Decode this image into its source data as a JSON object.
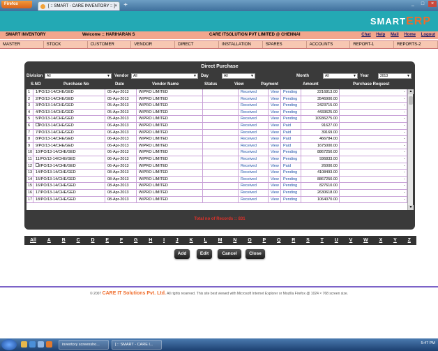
{
  "browser": {
    "app_button": "Firefox",
    "tab_title": "[ :: SMART - CARE INVENTORY :: ]",
    "tab_close": "×",
    "new_tab": "+",
    "window_controls": [
      "_",
      "□",
      "×"
    ]
  },
  "header": {
    "logo_smart": "SMART",
    "logo_erp": "ERP",
    "app_name": "SMART INVENTORY",
    "welcome": "Welcome :: HARIHARAN S",
    "company": "CARE ITSOLUTION PVT LIMITED @ CHENNAI",
    "links": [
      "Chat",
      "Help",
      "Mail",
      "Home",
      "Logout"
    ]
  },
  "menu": [
    "MASTER",
    "STOCK",
    "CUSTOMER",
    "VENDOR",
    "DIRECT",
    "INSTALLATION",
    "SPARES",
    "ACCOUNTS",
    "REPORT-1",
    "REPORTS-2"
  ],
  "panel": {
    "title": "Direct Purchase",
    "filters": {
      "division_label": "Division",
      "division_value": "All",
      "vendor_label": "Vendor",
      "vendor_value": "All",
      "day_label": "Day",
      "day_value": "All",
      "month_label": "Month",
      "month_value": "All",
      "year_label": "Year",
      "year_value": "2013"
    },
    "columns": [
      "S.NO",
      "Purchase No",
      "Date",
      "Vendor Name",
      "Status",
      "View",
      "Payment",
      "Amount",
      "Purchase Request"
    ],
    "rows": [
      {
        "sno": "1",
        "pno": "1/PO/13-14/CHE/GED",
        "date": "05-Apr-2013",
        "vendor": "WIPRO LIMITED",
        "status": "",
        "view": "Received",
        "pview": "View",
        "pay": "Pending",
        "amount": "2216813.00",
        "req": "-",
        "cb": false
      },
      {
        "sno": "2",
        "pno": "2/PO/13-14/CHE/GED",
        "date": "05-Apr-2013",
        "vendor": "WIPRO LIMITED",
        "status": "",
        "view": "Received",
        "pview": "View",
        "pay": "Pending",
        "amount": "3546900.00",
        "req": "-",
        "cb": false
      },
      {
        "sno": "3",
        "pno": "3/PO/13-14/CHE/GED",
        "date": "05-Apr-2013",
        "vendor": "WIPRO LIMITED",
        "status": "",
        "view": "Received",
        "pview": "View",
        "pay": "Pending",
        "amount": "2423715.00",
        "req": "-",
        "cb": false
      },
      {
        "sno": "4",
        "pno": "4/PO/13-14/CHE/GED",
        "date": "05-Apr-2013",
        "vendor": "WIPRO LIMITED",
        "status": "",
        "view": "Received",
        "pview": "View",
        "pay": "Pending",
        "amount": "4433625.00",
        "req": "-",
        "cb": false
      },
      {
        "sno": "5",
        "pno": "5/PO/13-14/CHE/GED",
        "date": "05-Apr-2013",
        "vendor": "WIPRO LIMITED",
        "status": "",
        "view": "Received",
        "pview": "View",
        "pay": "Pending",
        "amount": "10936275.00",
        "req": "-",
        "cb": false
      },
      {
        "sno": "6",
        "pno": "6/PO/13-14/CHE/GED",
        "date": "06-Apr-2013",
        "vendor": "WIPRO LIMITED",
        "status": "",
        "view": "Received",
        "pview": "View",
        "pay": "Paid",
        "amount": "91627.00",
        "req": "-",
        "cb": true
      },
      {
        "sno": "7",
        "pno": "7/PO/13-14/CHE/GED",
        "date": "06-Apr-2013",
        "vendor": "WIPRO LIMITED",
        "status": "",
        "view": "Received",
        "pview": "View",
        "pay": "Paid",
        "amount": "39169.00",
        "req": "-",
        "cb": false
      },
      {
        "sno": "8",
        "pno": "8/PO/13-14/CHE/GED",
        "date": "06-Apr-2013",
        "vendor": "WIPRO LIMITED",
        "status": "",
        "view": "Received",
        "pview": "View",
        "pay": "Paid",
        "amount": "466784.00",
        "req": "-",
        "cb": false
      },
      {
        "sno": "9",
        "pno": "9/PO/13-14/CHE/GED",
        "date": "06-Apr-2013",
        "vendor": "WIPRO LIMITED",
        "status": "",
        "view": "Received",
        "pview": "View",
        "pay": "Paid",
        "amount": "1675000.00",
        "req": "-",
        "cb": false
      },
      {
        "sno": "10",
        "pno": "10/PO/13-14/CHE/GED",
        "date": "06-Apr-2013",
        "vendor": "WIPRO LIMITED",
        "status": "",
        "view": "Received",
        "pview": "View",
        "pay": "Pending",
        "amount": "8867250.00",
        "req": "-",
        "cb": false
      },
      {
        "sno": "11",
        "pno": "11/PO/13-14/CHE/GED",
        "date": "06-Apr-2013",
        "vendor": "WIPRO LIMITED",
        "status": "",
        "view": "Received",
        "pview": "View",
        "pay": "Pending",
        "amount": "936833.00",
        "req": "-",
        "cb": false
      },
      {
        "sno": "12",
        "pno": "13/PO/13-14/CHE/GED",
        "date": "06-Apr-2013",
        "vendor": "WIPRO LIMITED",
        "status": "",
        "view": "Received",
        "pview": "View",
        "pay": "Paid",
        "amount": "26000.00",
        "req": "-",
        "cb": true
      },
      {
        "sno": "13",
        "pno": "14/PO/13-14/CHE/GED",
        "date": "08-Apr-2013",
        "vendor": "WIPRO LIMITED",
        "status": "",
        "view": "Received",
        "pview": "View",
        "pay": "Pending",
        "amount": "4108493.00",
        "req": "-",
        "cb": false
      },
      {
        "sno": "14",
        "pno": "15/PO/13-14/CHE/GED",
        "date": "08-Apr-2013",
        "vendor": "WIPRO LIMITED",
        "status": "",
        "view": "Received",
        "pview": "View",
        "pay": "Pending",
        "amount": "8867250.00",
        "req": "-",
        "cb": false
      },
      {
        "sno": "15",
        "pno": "16/PO/13-14/CHE/GED",
        "date": "08-Apr-2013",
        "vendor": "WIPRO LIMITED",
        "status": "",
        "view": "Received",
        "pview": "View",
        "pay": "Pending",
        "amount": "827610.00",
        "req": "-",
        "cb": false
      },
      {
        "sno": "16",
        "pno": "17/PO/13-14/CHE/GED",
        "date": "08-Apr-2013",
        "vendor": "WIPRO LIMITED",
        "status": "",
        "view": "Received",
        "pview": "View",
        "pay": "Pending",
        "amount": "2630618.00",
        "req": "-",
        "cb": false
      },
      {
        "sno": "17",
        "pno": "18/PO/13-14/CHE/GED",
        "date": "08-Apr-2013",
        "vendor": "WIPRO LIMITED",
        "status": "",
        "view": "Received",
        "pview": "View",
        "pay": "Pending",
        "amount": "1064070.00",
        "req": "-",
        "cb": false
      }
    ],
    "total": "Total no of Records :: 831"
  },
  "alphabet": [
    "All",
    "A",
    "B",
    "C",
    "D",
    "E",
    "F",
    "G",
    "H",
    "I",
    "J",
    "K",
    "L",
    "M",
    "N",
    "O",
    "P",
    "Q",
    "R",
    "S",
    "T",
    "U",
    "V",
    "W",
    "X",
    "Y",
    "Z"
  ],
  "buttons": [
    "Add",
    "Edit",
    "Cancel",
    "Close"
  ],
  "footer": {
    "copy": "© 2007",
    "company": "CARE IT Solutions Pvt. Ltd.",
    "note": "All rights reserved.   This site best viewed with Microsoft Internet Explorer or Mozilla Firefox @ 1024 × 768 screen size."
  },
  "taskbar": {
    "items": [
      "inventory screensho...",
      "[ :: SMART - CARE I..."
    ],
    "clock": "5:47 PM"
  },
  "colors": {
    "banner": "#23a9b4",
    "accent": "#ef6b2a",
    "panel": "#3a3a3a",
    "link": "#1a4fa8"
  }
}
